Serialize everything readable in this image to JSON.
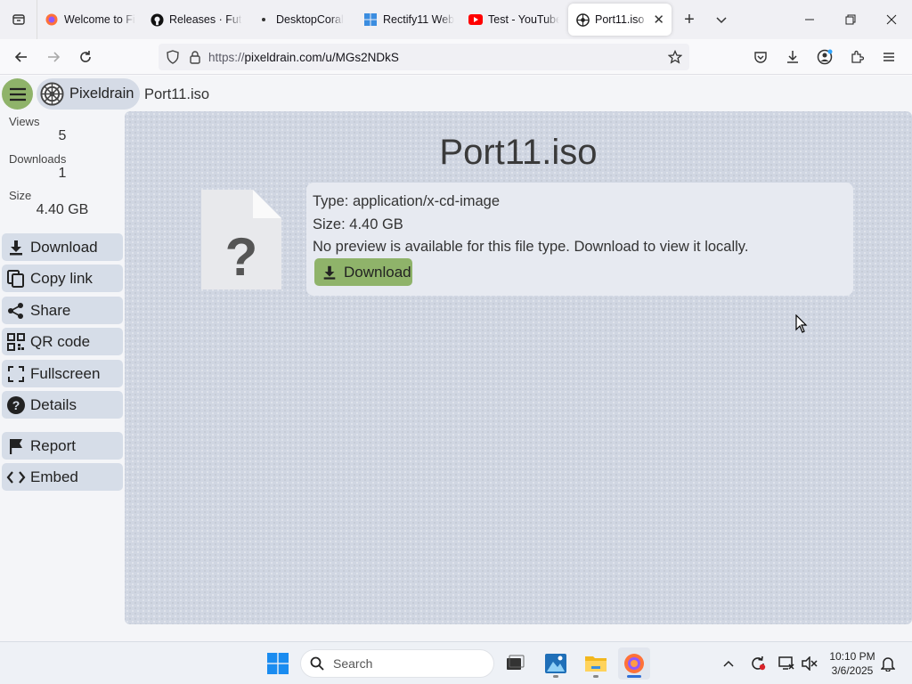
{
  "browser": {
    "tabs": [
      {
        "label": "Welcome to Fi",
        "icon": "firefox-icon"
      },
      {
        "label": "Releases · Futu",
        "icon": "github-icon"
      },
      {
        "label": "DesktopCoral",
        "icon": "dot-icon"
      },
      {
        "label": "Rectify11 Web",
        "icon": "windows-icon"
      },
      {
        "label": "Test - YouTube",
        "icon": "youtube-icon"
      },
      {
        "label": "Port11.iso ~",
        "icon": "pixeldrain-icon",
        "active": true
      }
    ],
    "url_prefix": "https://",
    "url_main": "pixeldrain.com/u/MGs2NDkS"
  },
  "app": {
    "brand": "Pixeldrain",
    "file_title": "Port11.iso"
  },
  "sidebar": {
    "stats": [
      {
        "label": "Views",
        "value": "5"
      },
      {
        "label": "Downloads",
        "value": "1"
      },
      {
        "label": "Size",
        "value": "4.40 GB"
      }
    ],
    "buttons": [
      {
        "label": "Download",
        "icon": "download-icon"
      },
      {
        "label": "Copy link",
        "icon": "copy-icon"
      },
      {
        "label": "Share",
        "icon": "share-icon"
      },
      {
        "label": "QR code",
        "icon": "qr-code-icon"
      },
      {
        "label": "Fullscreen",
        "icon": "fullscreen-icon"
      },
      {
        "label": "Details",
        "icon": "help-icon"
      },
      {
        "label": "Report",
        "icon": "flag-icon"
      },
      {
        "label": "Embed",
        "icon": "code-icon"
      }
    ]
  },
  "viewer": {
    "title": "Port11.iso",
    "type_line": "Type: application/x-cd-image",
    "size_line": "Size: 4.40 GB",
    "preview_line": "No preview is available for this file type. Download to view it locally.",
    "download_label": "Download"
  },
  "taskbar": {
    "search_placeholder": "Search",
    "time": "10:10 PM",
    "date": "3/6/2025"
  },
  "colors": {
    "accent_green": "#8fb36a",
    "button_bg": "#d6dde8",
    "viewer_bg": "#d0d6e2"
  }
}
